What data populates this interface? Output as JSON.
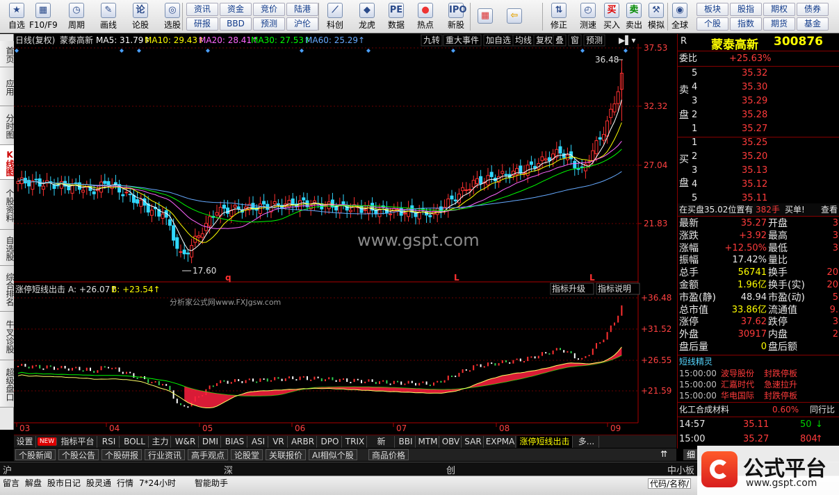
{
  "toolbar": {
    "buttons": [
      {
        "label": "自选",
        "icon": "star-icon"
      },
      {
        "label": "F10/F9",
        "icon": "f10-icon"
      },
      {
        "label": "周期",
        "icon": "clock-icon"
      },
      {
        "label": "画线",
        "icon": "pen-icon"
      },
      {
        "label": "论股",
        "icon": "discuss-icon"
      },
      {
        "label": "选股",
        "icon": "select-stock-icon"
      },
      {
        "label": "科创",
        "icon": "kechuang-icon"
      },
      {
        "label": "龙虎",
        "icon": "dragon-icon"
      },
      {
        "label": "数据",
        "icon": "pe-icon"
      },
      {
        "label": "热点",
        "icon": "hot-icon"
      },
      {
        "label": "新股",
        "icon": "ipo-icon"
      },
      {
        "label": "修正",
        "icon": "up-down-icon"
      },
      {
        "label": "测速",
        "icon": "speed-clock-icon"
      },
      {
        "label": "买入",
        "icon": "buy-icon"
      },
      {
        "label": "卖出",
        "icon": "sell-icon"
      },
      {
        "label": "模拟",
        "icon": "hammer-icon"
      },
      {
        "label": "全球",
        "icon": "globe-icon"
      }
    ],
    "small_buttons": [
      "资讯",
      "资金",
      "竞价",
      "陆港",
      "研报",
      "BBD",
      "预测",
      "沪伦",
      "板块",
      "股指",
      "期权",
      "债券",
      "个股",
      "指数",
      "期货",
      "基金"
    ],
    "buy_glyph": "买",
    "sell_glyph": "卖"
  },
  "leftnav": {
    "tabs": [
      "首页",
      "应用",
      "分时图",
      "K线图",
      "个股资料",
      "自选股",
      "综合排名",
      "牛叉诊股",
      "超级盘口"
    ]
  },
  "chart": {
    "header": {
      "period": "日线(复权)",
      "name": "蒙泰高新",
      "ma": [
        {
          "label": "MA5: 31.79↑",
          "color": "#ffffff"
        },
        {
          "label": "MA10: 29.43↑",
          "color": "#ffff00"
        },
        {
          "label": "MA20: 28.41↑",
          "color": "#ff66ff"
        },
        {
          "label": "MA30: 27.53↑",
          "color": "#00ff00"
        },
        {
          "label": "MA60: 25.29↑",
          "color": "#66aaff"
        }
      ],
      "menu": [
        "九转",
        "重大事件",
        "加自选",
        "均线",
        "复权",
        "叠",
        "窗",
        "预测"
      ]
    },
    "price_axis": [
      "37.53",
      "32.32",
      "27.04",
      "21.83"
    ],
    "annotations": {
      "high": "36.48",
      "low": "17.60",
      "markers": [
        "q",
        "L",
        "L"
      ]
    },
    "watermark": "www.gspt.com",
    "indicator": {
      "name": "涨停短线出击",
      "a_label": "A: +26.07↑",
      "b_label": "B: +23.54↑",
      "buttons": [
        "指标升级",
        "指标说明"
      ],
      "axis": [
        "+36.48",
        "+31.52",
        "+26.55",
        "+21.59"
      ],
      "site": "分析家公式网www.FXJgsw.com"
    },
    "date_axis": [
      "03",
      "04",
      "05",
      "06",
      "07",
      "08",
      "09"
    ]
  },
  "quote": {
    "r_label": "R",
    "title": "蒙泰高新",
    "code": "300876",
    "weibi_label": "委比",
    "weibi": "+25.63%",
    "sell_label": [
      "卖",
      "盘"
    ],
    "buy_label": [
      "买",
      "盘"
    ],
    "sells": [
      {
        "lvl": "5",
        "price": "35.32"
      },
      {
        "lvl": "4",
        "price": "35.30"
      },
      {
        "lvl": "3",
        "price": "35.29"
      },
      {
        "lvl": "2",
        "price": "35.28"
      },
      {
        "lvl": "1",
        "price": "35.27"
      }
    ],
    "buys": [
      {
        "lvl": "1",
        "price": "35.25"
      },
      {
        "lvl": "2",
        "price": "35.20"
      },
      {
        "lvl": "3",
        "price": "35.13"
      },
      {
        "lvl": "4",
        "price": "35.12"
      },
      {
        "lvl": "5",
        "price": "35.11"
      }
    ],
    "pending": {
      "text": "在买盘35.02位置有",
      "vol": "382手",
      "action": "买单!",
      "check": "查看"
    },
    "stats_left": [
      {
        "label": "最新",
        "value": "35.27",
        "color": "#ff3b3b"
      },
      {
        "label": "涨跌",
        "value": "+3.92",
        "color": "#ff3b3b"
      },
      {
        "label": "涨幅",
        "value": "+12.50%",
        "color": "#ff3b3b"
      },
      {
        "label": "振幅",
        "value": "17.42%",
        "color": "#e8e8e8"
      },
      {
        "label": "总手",
        "value": "56741",
        "color": "#ffff00"
      },
      {
        "label": "金额",
        "value": "1.96亿",
        "color": "#ffff00"
      },
      {
        "label": "市盈(静)",
        "value": "48.94",
        "color": "#e8e8e8"
      },
      {
        "label": "总市值",
        "value": "33.86亿",
        "color": "#ffff00"
      },
      {
        "label": "涨停",
        "value": "37.62",
        "color": "#ff3b3b"
      },
      {
        "label": "外盘",
        "value": "30917",
        "color": "#ff3b3b"
      },
      {
        "label": "盘后量",
        "value": "0",
        "color": "#ffff00"
      }
    ],
    "stats_right": [
      {
        "label": "开盘",
        "value": "3"
      },
      {
        "label": "最高",
        "value": "3"
      },
      {
        "label": "最低",
        "value": "3"
      },
      {
        "label": "量比",
        "value": ""
      },
      {
        "label": "换手",
        "value": "20"
      },
      {
        "label": "换手(实)",
        "value": "20"
      },
      {
        "label": "市盈(动)",
        "value": "5"
      },
      {
        "label": "流通值",
        "value": "9."
      },
      {
        "label": "跌停",
        "value": "3"
      },
      {
        "label": "内盘",
        "value": "2"
      },
      {
        "label": "盘后额",
        "value": ""
      }
    ],
    "sprite_title": "短线精灵",
    "sprite": [
      {
        "time": "15:00:00",
        "stock": "波导股份",
        "event": "封跌停板"
      },
      {
        "time": "15:00:00",
        "stock": "汇嘉时代",
        "event": "急速拉升"
      },
      {
        "time": "15:00:00",
        "stock": "华电国际",
        "event": "封跌停板"
      }
    ],
    "industry": {
      "name": "化工合成材料",
      "pct": "0.60%",
      "tab": "同行比"
    },
    "ticks": [
      {
        "time": "14:57",
        "price": "35.11",
        "vol": "50",
        "dir": "↓"
      },
      {
        "time": "15:00",
        "price": "35.27",
        "vol": "804",
        "dir": "↑"
      }
    ],
    "detail_tab": "细"
  },
  "indicator_tabs": [
    "设置",
    "NEW",
    "指标平台",
    "RSI",
    "BOLL",
    "主力",
    "W&R",
    "DMI",
    "BIAS",
    "ASI",
    "VR",
    "ARBR",
    "DPO",
    "TRIX",
    "新DMA",
    "BBI",
    "MTM",
    "OBV",
    "SAR",
    "EXPMA",
    "涨停短线出击",
    "多..."
  ],
  "info_tabs": [
    "个股新闻",
    "个股公告",
    "个股研报",
    "行业资讯",
    "高手观点",
    "论股堂",
    "关联报价",
    "AI相似个股",
    "商品价格"
  ],
  "ticker": {
    "sh": "沪",
    "sz": "深",
    "cy": "创",
    "zx": "中小板"
  },
  "statusbar": {
    "items": [
      "留言",
      "解盘",
      "股市日记",
      "股灵通",
      "行情",
      "7*24小时",
      "智能助手"
    ],
    "code_label": "代码/名称/"
  },
  "logo": {
    "text": "公式平台",
    "url": "www.gspt.com"
  }
}
